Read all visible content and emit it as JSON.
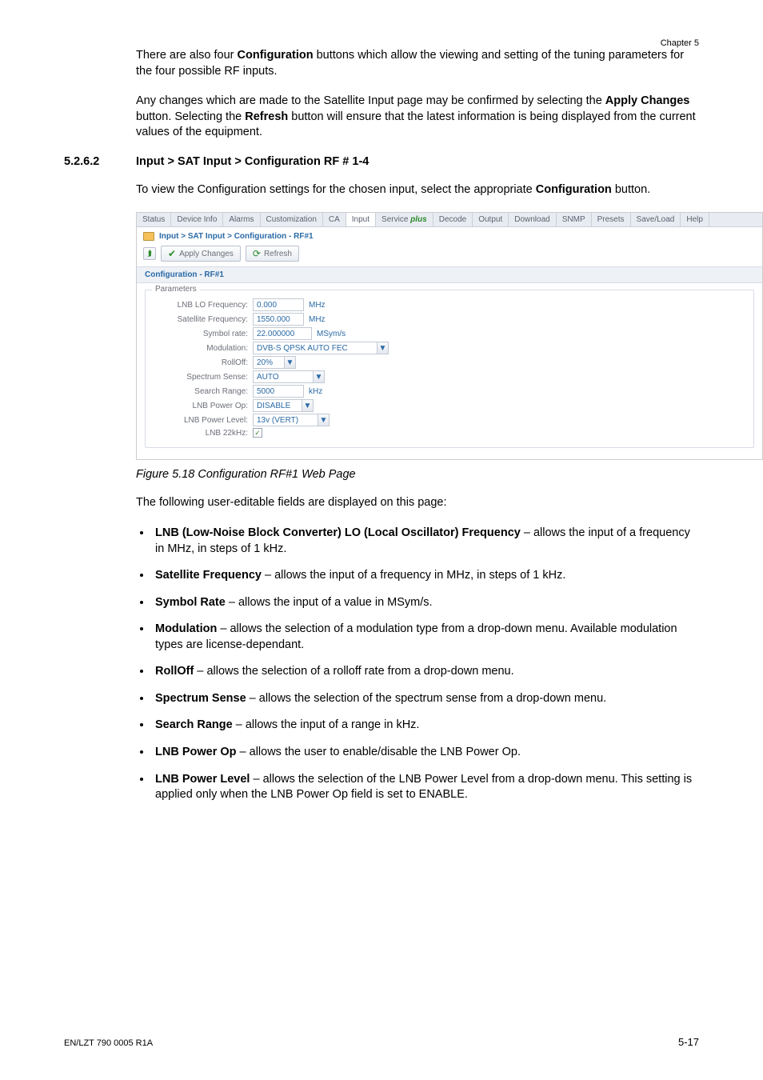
{
  "chapter": "Chapter 5",
  "intro1_a": "There are also four ",
  "intro1_b": "Configuration",
  "intro1_c": " buttons which allow the viewing and setting of the tuning parameters for the four possible RF inputs.",
  "intro2_a": "Any changes which are made to the Satellite Input page may be confirmed by selecting the ",
  "intro2_b": "Apply Changes",
  "intro2_c": " button. Selecting the ",
  "intro2_d": "Refresh",
  "intro2_e": " button will ensure that the latest information is being displayed from the current values of the equipment.",
  "section_number": "5.2.6.2",
  "section_title": "Input > SAT Input > Configuration RF # 1-4",
  "intro3_a": "To view the Configuration settings for the chosen input, select the appropriate ",
  "intro3_b": "Configuration",
  "intro3_c": " button.",
  "figure_caption": "Figure 5.18 Configuration RF#1 Web Page",
  "following": "The following user-editable fields are displayed on this page:",
  "bullets": {
    "b1_bold": "LNB (Low-Noise Block Converter) LO (Local Oscillator) Frequency",
    "b1_rest": " – allows the input of a frequency in MHz, in steps of 1 kHz.",
    "b2_bold": "Satellite Frequency",
    "b2_rest": " – allows the input of a frequency in MHz, in steps of 1 kHz.",
    "b3_bold": "Symbol Rate",
    "b3_rest": " – allows the input of a value in MSym/s.",
    "b4_bold": "Modulation",
    "b4_rest": " – allows the selection of a modulation type from a drop-down menu. Available modulation types are license-dependant.",
    "b5_bold": "RollOff",
    "b5_rest": " – allows the selection of a rolloff rate from a drop-down menu.",
    "b6_bold": "Spectrum Sense",
    "b6_rest": " – allows the selection of the spectrum sense from a drop-down menu.",
    "b7_bold": "Search Range",
    "b7_rest": " – allows the input of a range in kHz.",
    "b8_bold": "LNB Power Op",
    "b8_rest": " – allows the user to enable/disable the LNB Power Op.",
    "b9_bold": "LNB Power Level",
    "b9_rest": " – allows the selection of the LNB Power Level from a drop-down menu. This setting is applied only when the LNB Power Op field is set to ENABLE."
  },
  "footer_left": "EN/LZT 790 0005 R1A",
  "footer_right": "5-17",
  "shot": {
    "tabs": [
      "Status",
      "Device Info",
      "Alarms",
      "Customization",
      "CA",
      "Input",
      "Service",
      "plus",
      "Decode",
      "Output",
      "Download",
      "SNMP",
      "Presets",
      "Save/Load",
      "Help"
    ],
    "selected_tab_index": 5,
    "breadcrumb": "Input > SAT Input > Configuration - RF#1",
    "apply": "Apply Changes",
    "refresh": "Refresh",
    "panel_title": "Configuration - RF#1",
    "legend": "Parameters",
    "rows": {
      "lnb_lo": {
        "label": "LNB LO Frequency:",
        "value": "0.000",
        "unit": "MHz"
      },
      "sat_freq": {
        "label": "Satellite Frequency:",
        "value": "1550.000",
        "unit": "MHz"
      },
      "sym_rate": {
        "label": "Symbol rate:",
        "value": "22.000000",
        "unit": "MSym/s"
      },
      "modulation": {
        "label": "Modulation:",
        "value": "DVB-S QPSK AUTO FEC"
      },
      "rolloff": {
        "label": "RollOff:",
        "value": "20%"
      },
      "spectrum": {
        "label": "Spectrum Sense:",
        "value": "AUTO"
      },
      "search": {
        "label": "Search Range:",
        "value": "5000",
        "unit": "kHz"
      },
      "power_op": {
        "label": "LNB Power Op:",
        "value": "DISABLE"
      },
      "power_level": {
        "label": "LNB Power Level:",
        "value": "13v (VERT)"
      },
      "lnb22": {
        "label": "LNB 22kHz:",
        "checked": "✓"
      }
    }
  }
}
